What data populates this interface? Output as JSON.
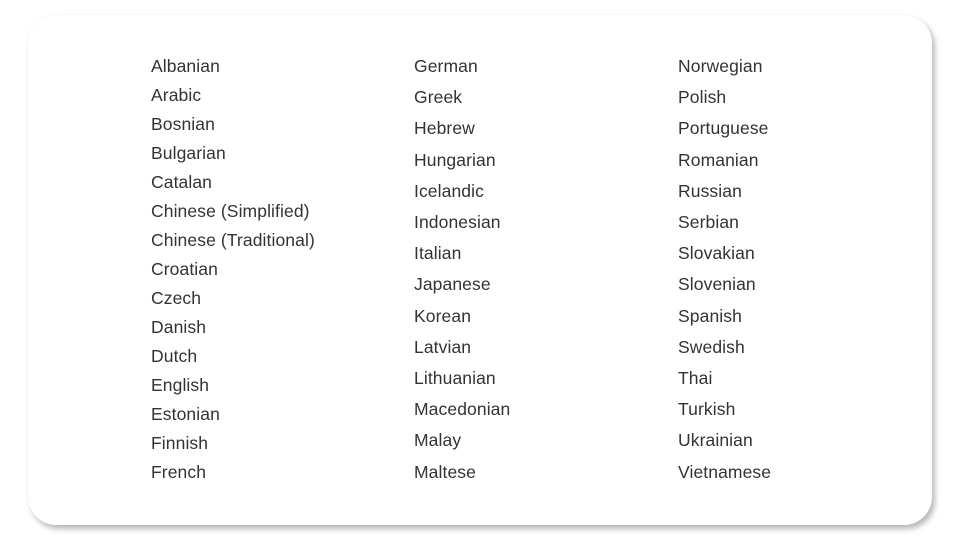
{
  "languages": {
    "columns": [
      [
        "Albanian",
        "Arabic",
        "Bosnian",
        "Bulgarian",
        "Catalan",
        "Chinese (Simplified)",
        "Chinese (Traditional)",
        "Croatian",
        "Czech",
        "Danish",
        "Dutch",
        "English",
        "Estonian",
        "Finnish",
        "French"
      ],
      [
        "German",
        "Greek",
        "Hebrew",
        "Hungarian",
        "Icelandic",
        "Indonesian",
        "Italian",
        "Japanese",
        "Korean",
        "Latvian",
        "Lithuanian",
        "Macedonian",
        "Malay",
        "Maltese"
      ],
      [
        "Norwegian",
        "Polish",
        "Portuguese",
        "Romanian",
        "Russian",
        "Serbian",
        "Slovakian",
        "Slovenian",
        "Spanish",
        "Swedish",
        "Thai",
        "Turkish",
        "Ukrainian",
        "Vietnamese"
      ]
    ]
  },
  "colors": {
    "text": "#333333",
    "card_background": "#ffffff"
  }
}
